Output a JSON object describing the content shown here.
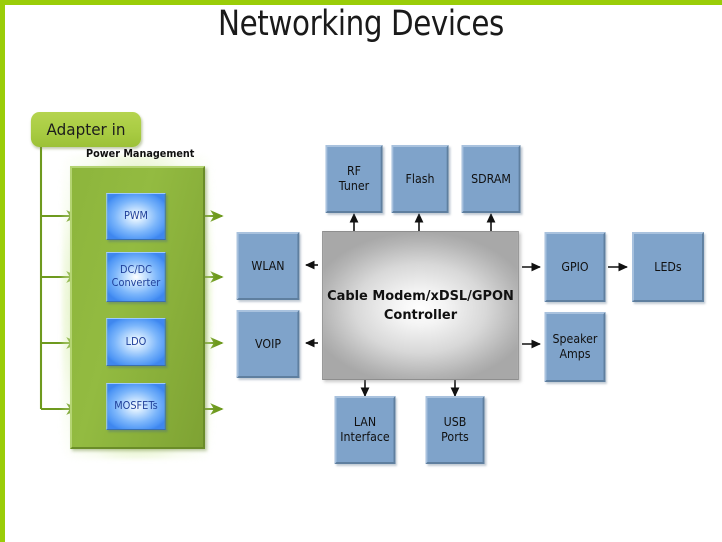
{
  "slide": {
    "title": "Networking Devices",
    "accent_green": "#9ACD08",
    "block_blue": "#7FA3CA",
    "arrow_green": "#6E9A1E",
    "arrow_black": "#111111"
  },
  "power": {
    "adapter_label": "Adapter in",
    "group_label": "Power Management",
    "blocks": [
      {
        "label": "PWM"
      },
      {
        "label": "DC/DC\nConverter",
        "line1": "DC/DC",
        "line2": "Converter"
      },
      {
        "label": "LDO"
      },
      {
        "label": "MOSFETs"
      }
    ]
  },
  "controller": {
    "line1": "Cable Modem/xDSL/GPON",
    "line2": "Controller"
  },
  "peripherals": {
    "top": [
      {
        "line1": "RF",
        "line2": "Tuner"
      },
      {
        "line1": "Flash",
        "line2": ""
      },
      {
        "line1": "SDRAM",
        "line2": ""
      }
    ],
    "left": [
      {
        "line1": "WLAN",
        "line2": ""
      },
      {
        "line1": "VOIP",
        "line2": ""
      }
    ],
    "right": [
      {
        "line1": "GPIO",
        "line2": ""
      },
      {
        "line1": "Speaker",
        "line2": "Amps"
      },
      {
        "line1": "LEDs",
        "line2": ""
      }
    ],
    "bottom": [
      {
        "line1": "LAN",
        "line2": "Interface"
      },
      {
        "line1": "USB",
        "line2": "Ports"
      }
    ]
  }
}
